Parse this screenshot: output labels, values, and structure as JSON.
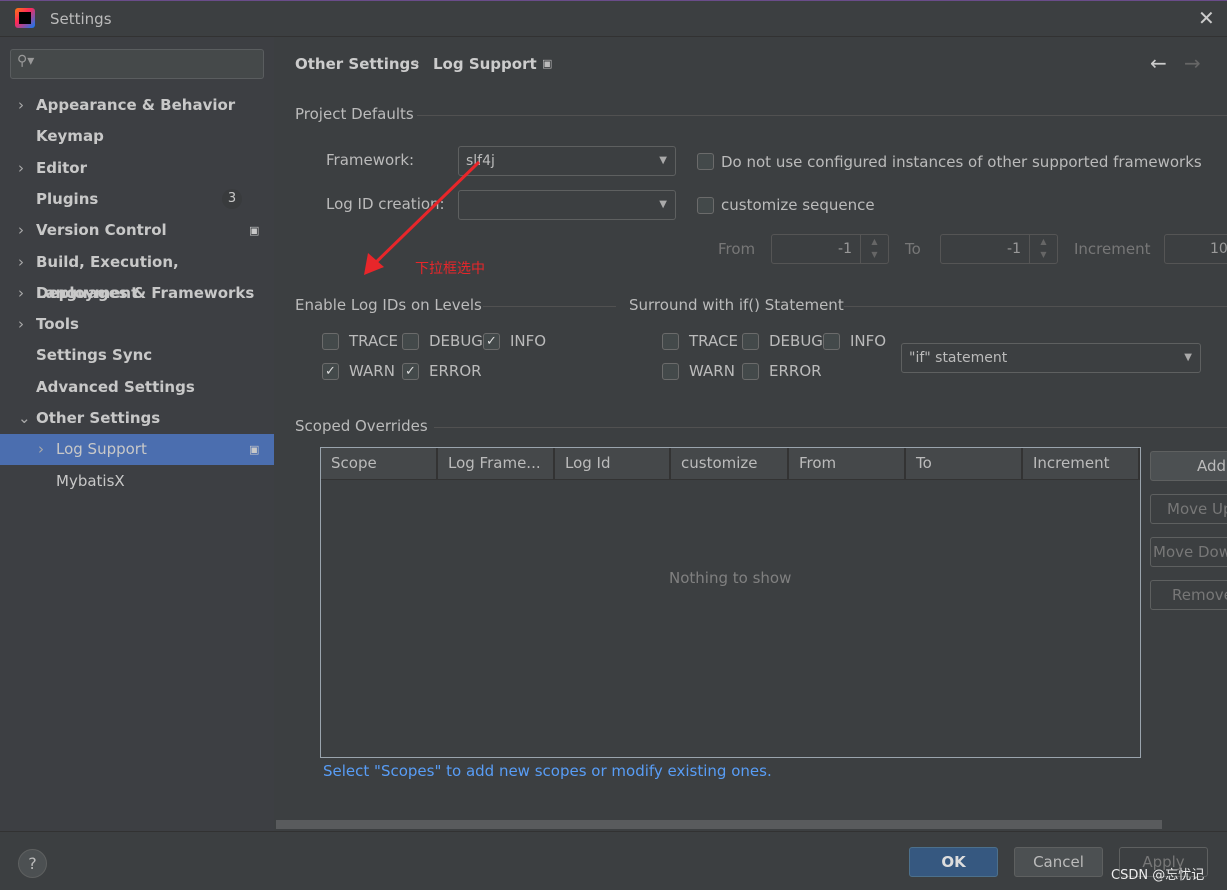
{
  "window": {
    "title": "Settings",
    "close_icon": "close-icon"
  },
  "sidebar": {
    "search_placeholder": "",
    "items": [
      {
        "label": "Appearance & Behavior",
        "expandable": true
      },
      {
        "label": "Keymap"
      },
      {
        "label": "Editor",
        "expandable": true
      },
      {
        "label": "Plugins",
        "badge": "3"
      },
      {
        "label": "Version Control",
        "expandable": true
      },
      {
        "label": "Build, Execution, Deployment",
        "expandable": true
      },
      {
        "label": "Languages & Frameworks",
        "expandable": true
      },
      {
        "label": "Tools",
        "expandable": true
      },
      {
        "label": "Settings Sync"
      },
      {
        "label": "Advanced Settings"
      },
      {
        "label": "Other Settings",
        "expanded": true
      },
      {
        "label": "Log Support",
        "selected": true
      },
      {
        "label": "MybatisX"
      }
    ]
  },
  "breadcrumb": {
    "parent": "Other Settings",
    "current": "Log Support"
  },
  "project_defaults": {
    "title": "Project Defaults",
    "framework_label": "Framework:",
    "framework_value": "slf4j",
    "dont_use_label": "Do not use configured instances of other supported frameworks",
    "log_id_label": "Log ID creation:",
    "log_id_value": "",
    "customize_label": "customize sequence",
    "from_label": "From",
    "from_value": "-1",
    "to_label": "To",
    "to_value": "-1",
    "increment_label": "Increment",
    "increment_value": "10"
  },
  "annotation": {
    "text": "下拉框选中",
    "color": "#e8262a"
  },
  "enable_levels": {
    "title": "Enable Log IDs on Levels",
    "levels": [
      {
        "label": "TRACE",
        "checked": false
      },
      {
        "label": "DEBUG",
        "checked": false
      },
      {
        "label": "INFO",
        "checked": true
      },
      {
        "label": "WARN",
        "checked": true
      },
      {
        "label": "ERROR",
        "checked": true
      }
    ]
  },
  "surround": {
    "title": "Surround with if() Statement",
    "levels": [
      {
        "label": "TRACE",
        "checked": false
      },
      {
        "label": "DEBUG",
        "checked": false
      },
      {
        "label": "INFO",
        "checked": false
      },
      {
        "label": "WARN",
        "checked": false
      },
      {
        "label": "ERROR",
        "checked": false
      }
    ],
    "statement_value": "\"if\" statement"
  },
  "scoped": {
    "title": "Scoped Overrides",
    "columns": [
      "Scope",
      "Log Frame...",
      "Log Id",
      "customize",
      "From",
      "To",
      "Increment"
    ],
    "empty_text": "Nothing to show",
    "hint": "Select \"Scopes\" to add new scopes or modify existing ones.",
    "buttons": [
      "Add",
      "Move Up",
      "Move Down",
      "Remove"
    ]
  },
  "footer": {
    "help": "?",
    "ok": "OK",
    "cancel": "Cancel",
    "apply": "Apply",
    "watermark": "CSDN @忘忧记"
  },
  "colors": {
    "accent": "#4b6eaf",
    "ok_button": "#365880",
    "link": "#589df6"
  }
}
